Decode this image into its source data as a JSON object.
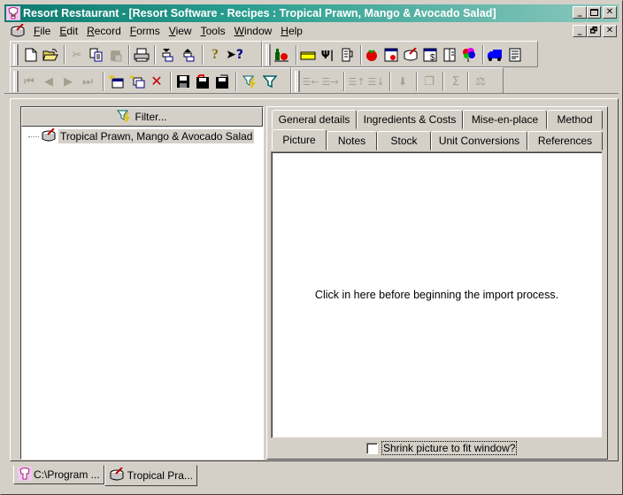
{
  "window": {
    "title": "Resort Restaurant - [Resort Software - Recipes : Tropical Prawn, Mango & Avocado Salad]",
    "caption_buttons": [
      "minimize",
      "maximize",
      "close"
    ],
    "mdi_buttons": [
      "minimize",
      "restore",
      "close"
    ]
  },
  "menu": {
    "items": [
      {
        "label": "File",
        "accel": "F"
      },
      {
        "label": "Edit",
        "accel": "E"
      },
      {
        "label": "Record",
        "accel": "R"
      },
      {
        "label": "Forms",
        "accel": "F"
      },
      {
        "label": "View",
        "accel": "V"
      },
      {
        "label": "Tools",
        "accel": "T"
      },
      {
        "label": "Window",
        "accel": "W"
      },
      {
        "label": "Help",
        "accel": "H"
      }
    ]
  },
  "toolbar1": {
    "icons": [
      "new-document",
      "open-folder",
      "cut",
      "copy",
      "paste",
      "print",
      "move-down",
      "move-up",
      "help",
      "whats-this-help"
    ]
  },
  "toolbar2": {
    "icons": [
      "wine-tomato",
      "cheese",
      "cutlery",
      "measuring-jug",
      "tomato",
      "ingredient-list",
      "recipe-pot",
      "cost-sheet",
      "menu-book",
      "balloons",
      "delivery-truck",
      "report"
    ]
  },
  "toolbar3": {
    "icons": [
      "first-record",
      "previous-record",
      "next-record",
      "last-record",
      "new-record",
      "duplicate-record",
      "delete-record",
      "save",
      "undo-save",
      "save-as",
      "quick-filter",
      "filter"
    ],
    "disabled": [
      "first-record",
      "previous-record",
      "next-record",
      "last-record"
    ]
  },
  "toolbar4": {
    "icons": [
      "indent-left",
      "indent-right",
      "move-item-up",
      "move-item-down",
      "import",
      "window-cascade",
      "sum",
      "scale"
    ]
  },
  "left_pane": {
    "filter_button": "Filter...",
    "tree": [
      {
        "label": "Tropical Prawn, Mango & Avocado Salad",
        "selected": true
      }
    ]
  },
  "tabs": {
    "row1": [
      "General details",
      "Ingredients & Costs",
      "Mise-en-place",
      "Method"
    ],
    "row2": [
      "Picture",
      "Notes",
      "Stock",
      "Unit Conversions",
      "References"
    ],
    "active": "Picture"
  },
  "picture_panel": {
    "message": "Click in here before beginning the import process.",
    "shrink_checkbox_label": "Shrink picture to fit window?",
    "shrink_checked": false
  },
  "window_tabs": [
    {
      "label": "C:\\Program ...",
      "active": false
    },
    {
      "label": "Tropical Pra...",
      "active": true
    }
  ]
}
